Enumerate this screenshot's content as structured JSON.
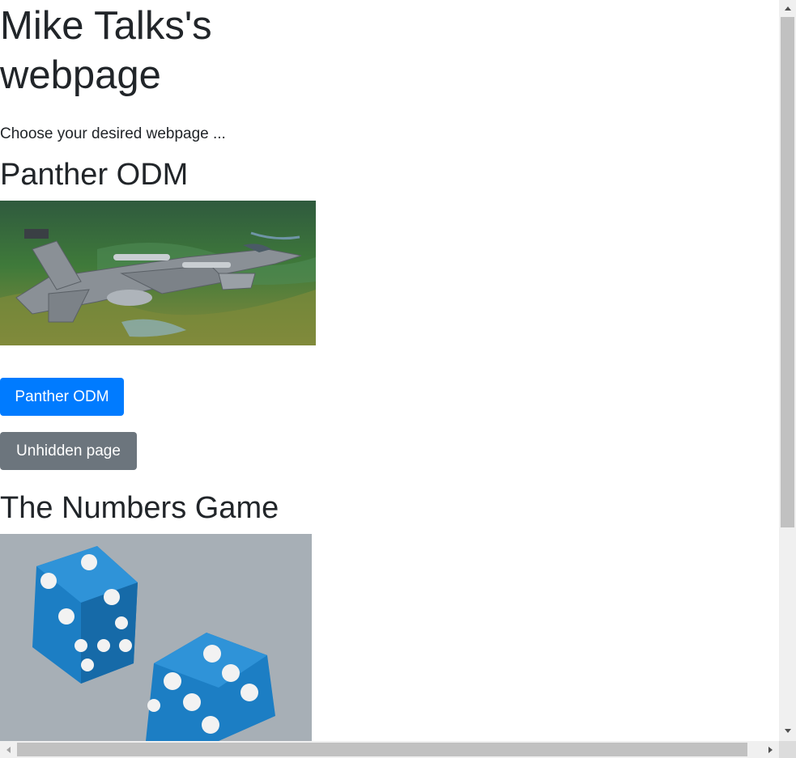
{
  "page": {
    "title": "Mike Talks's webpage",
    "intro": "Choose your desired webpage ..."
  },
  "sections": [
    {
      "heading": "Panther ODM",
      "image": "jet-fighter-photo",
      "buttons": [
        {
          "label": "Panther ODM",
          "color": "#007bff"
        },
        {
          "label": "Unhidden page",
          "color": "#6c757d"
        }
      ]
    },
    {
      "heading": "The Numbers Game",
      "image": "blue-dice-photo"
    }
  ],
  "colors": {
    "text": "#212529",
    "primary": "#007bff",
    "secondary": "#6c757d"
  },
  "icons": {
    "scroll_up": "chevron-up-icon",
    "scroll_down": "chevron-down-icon",
    "scroll_left": "chevron-left-icon",
    "scroll_right": "chevron-right-icon"
  }
}
